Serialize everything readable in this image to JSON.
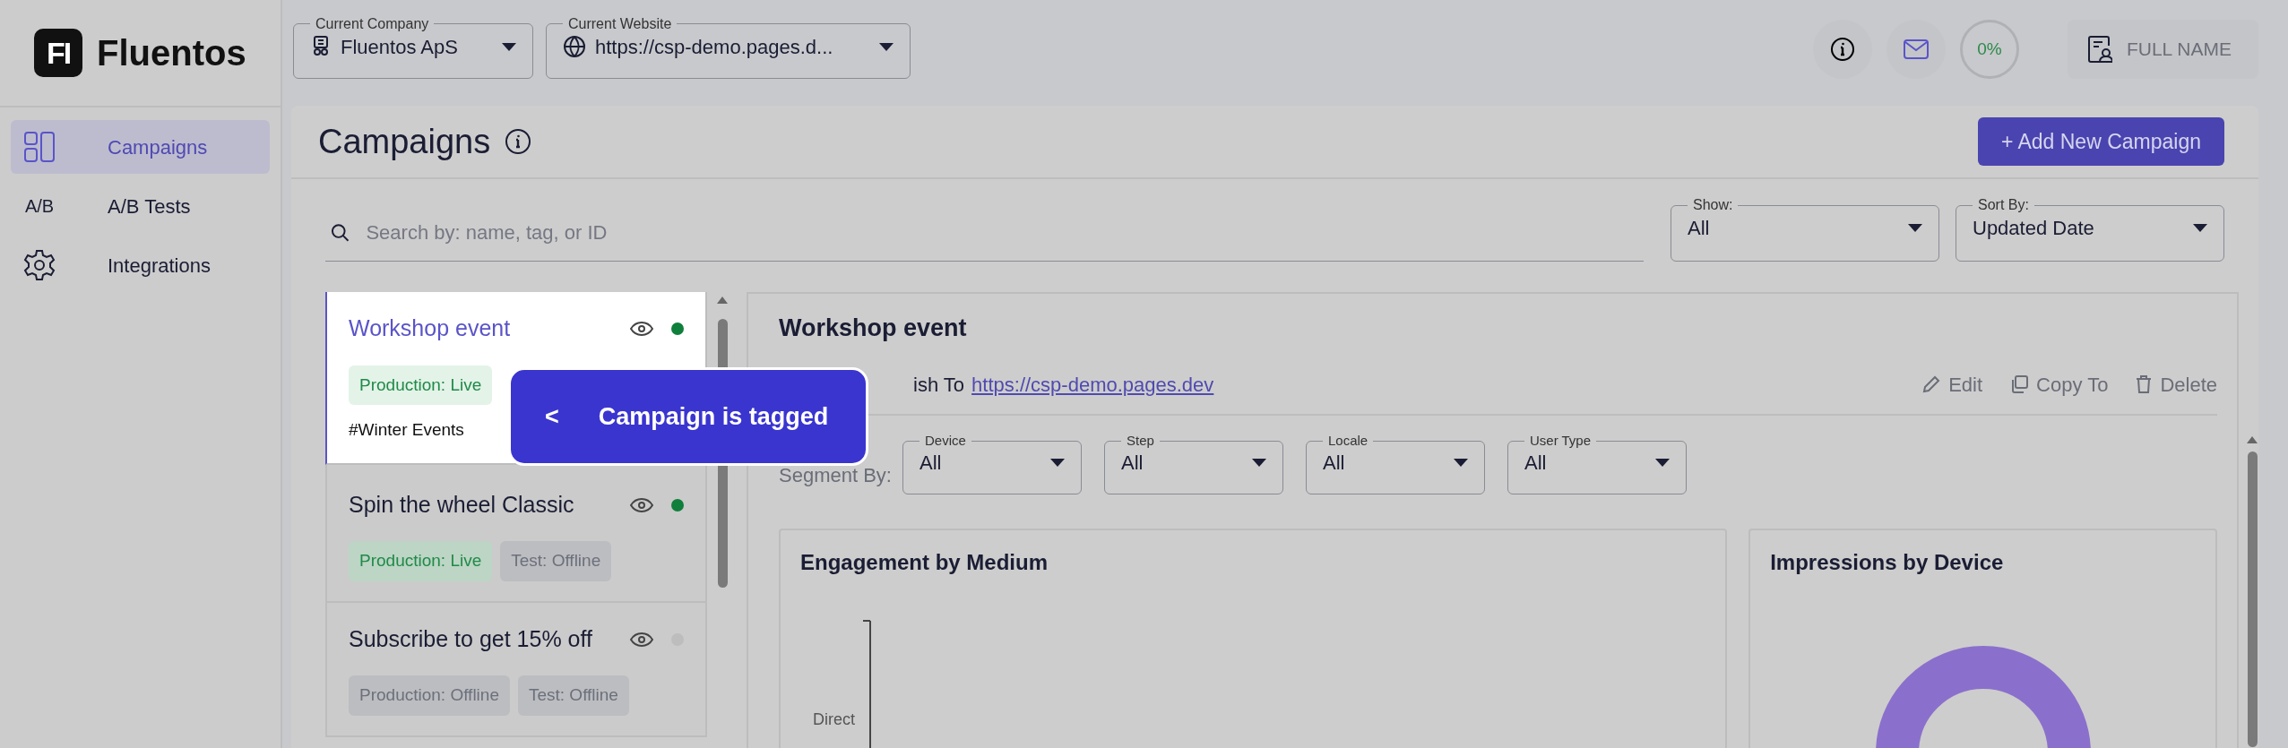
{
  "logo": {
    "mark": "FI",
    "text": "Fluentos"
  },
  "sidebar": {
    "items": [
      {
        "label": "Campaigns",
        "kind": "layout",
        "selected": true
      },
      {
        "label": "A/B Tests",
        "kind": "text",
        "icon_text": "A/B",
        "selected": false
      },
      {
        "label": "Integrations",
        "kind": "gear",
        "selected": false
      }
    ]
  },
  "top_bar": {
    "selects": [
      {
        "label": "Current Company",
        "value": "Fluentos ApS",
        "kind": "company"
      },
      {
        "label": "Current Website",
        "value": "https://csp-demo.pages.d...",
        "kind": "globe"
      }
    ],
    "progress": "0%",
    "user": "FULL NAME"
  },
  "page": {
    "title": "Campaigns",
    "add_button": "+ Add New Campaign",
    "search": {
      "placeholder": "Search by: name, tag, or ID"
    },
    "filters": [
      {
        "label": "Show:",
        "value": "All"
      },
      {
        "label": "Sort By:",
        "value": "Updated Date"
      }
    ]
  },
  "campaigns": [
    {
      "name": "Workshop event",
      "selected": true,
      "live": true,
      "badges": [
        {
          "text": "Production: Live",
          "kind": "live"
        }
      ],
      "tags": [
        "#Winter Events"
      ]
    },
    {
      "name": "Spin the wheel Classic",
      "selected": false,
      "live": true,
      "badges": [
        {
          "text": "Production: Live",
          "kind": "live"
        },
        {
          "text": "Test: Offline",
          "kind": "offline"
        }
      ]
    },
    {
      "name": "Subscribe to get 15% off",
      "selected": false,
      "live": false,
      "badges": [
        {
          "text": "Production: Offline",
          "kind": "offline"
        },
        {
          "text": "Test: Offline",
          "kind": "offline"
        }
      ]
    }
  ],
  "detail": {
    "title": "Workshop event",
    "publish_label": "ish To",
    "publish_url": "https://csp-demo.pages.dev",
    "actions": [
      {
        "label": "Edit",
        "kind": "edit"
      },
      {
        "label": "Copy To",
        "kind": "copy"
      },
      {
        "label": "Delete",
        "kind": "delete"
      }
    ],
    "segment_label": "Segment By:",
    "segments": [
      {
        "label": "Device",
        "value": "All"
      },
      {
        "label": "Step",
        "value": "All"
      },
      {
        "label": "Locale",
        "value": "All"
      },
      {
        "label": "User Type",
        "value": "All"
      }
    ],
    "charts": [
      {
        "title": "Engagement by Medium",
        "kind": "axis",
        "axis_label": "Direct"
      },
      {
        "title": "Impressions by Device",
        "kind": "donut"
      }
    ]
  },
  "tour": {
    "back": "<",
    "text": "Campaign is tagged"
  }
}
